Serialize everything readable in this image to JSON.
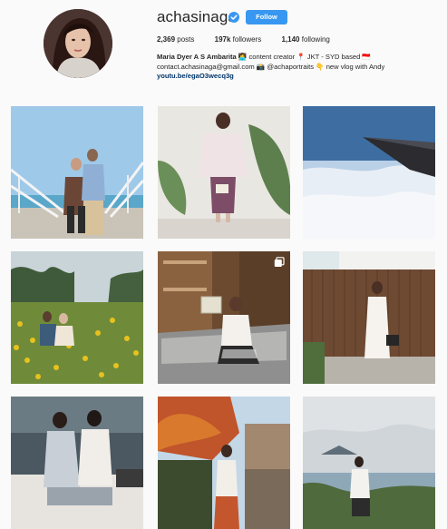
{
  "profile": {
    "username": "achasinaga",
    "follow_label": "Follow",
    "stats": {
      "posts_count": "2,369",
      "posts_label": "posts",
      "followers_count": "197k",
      "followers_label": "followers",
      "following_count": "1,140",
      "following_label": "following"
    },
    "bio": {
      "full_name": "Maria Dyer A S Ambarita",
      "line1_rest": " 👩‍💻 content creator 📍 JKT - SYD based 🇮🇩",
      "line2": "contact.achasinaga@gmail.com 📸 @achaportraits 👇 new vlog with Andy",
      "link": "youtu.be/egaO3wecq3g"
    }
  },
  "posts": [
    {
      "id": "post-1",
      "scene": "couple on pier by sea"
    },
    {
      "id": "post-2",
      "scene": "woman in white dress with tropical leaves"
    },
    {
      "id": "post-3",
      "scene": "airplane wing above clouds"
    },
    {
      "id": "post-4",
      "scene": "couple in yellow flower field"
    },
    {
      "id": "post-5",
      "scene": "woman on sofa holding box",
      "multiple": true
    },
    {
      "id": "post-6",
      "scene": "woman in white dress by wooden fence"
    },
    {
      "id": "post-7",
      "scene": "two women sitting on couch"
    },
    {
      "id": "post-8",
      "scene": "woman under autumn tree"
    },
    {
      "id": "post-9",
      "scene": "woman overlooking lake and mountains"
    }
  ],
  "colors": {
    "follow_button": "#3897f0",
    "verified_badge": "#3897f0",
    "link": "#003569"
  },
  "icons": {
    "verified": "verified-badge-icon",
    "multiple": "multiple-photos-icon"
  }
}
